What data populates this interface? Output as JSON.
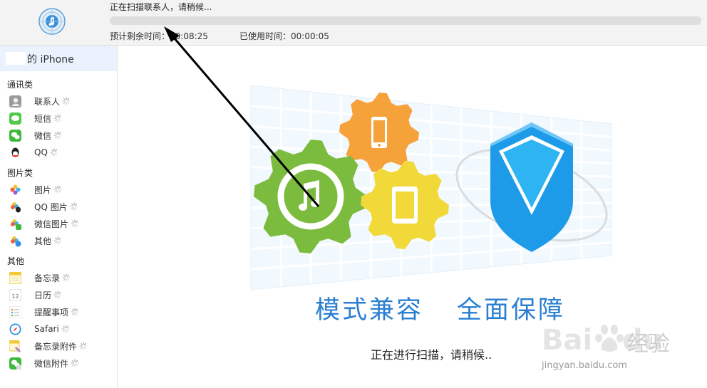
{
  "header": {
    "status_text": "正在扫描联系人，请稍候...",
    "progress_fraction": 0.0,
    "time_remaining": "预计剩余时间：00:08:25",
    "time_used": "已使用时间：00:00:05"
  },
  "sidebar": {
    "device_name": "的 iPhone",
    "groups": [
      {
        "title": "通讯类",
        "items": [
          {
            "label": "联系人",
            "icon": "contacts-icon"
          },
          {
            "label": "短信",
            "icon": "messages-icon"
          },
          {
            "label": "微信",
            "icon": "wechat-icon"
          },
          {
            "label": "QQ",
            "icon": "qq-icon"
          }
        ]
      },
      {
        "title": "图片类",
        "items": [
          {
            "label": "图片",
            "icon": "photos-icon"
          },
          {
            "label": "QQ 图片",
            "icon": "qq-photos-icon"
          },
          {
            "label": "微信图片",
            "icon": "wechat-photos-icon"
          },
          {
            "label": "其他",
            "icon": "other-photos-icon"
          }
        ]
      },
      {
        "title": "其他",
        "items": [
          {
            "label": "备忘录",
            "icon": "notes-icon"
          },
          {
            "label": "日历",
            "icon": "calendar-icon"
          },
          {
            "label": "提醒事项",
            "icon": "reminders-icon"
          },
          {
            "label": "Safari",
            "icon": "safari-icon"
          },
          {
            "label": "备忘录附件",
            "icon": "notes-attachments-icon"
          },
          {
            "label": "微信附件",
            "icon": "wechat-attachments-icon"
          }
        ]
      }
    ]
  },
  "main": {
    "slogan_left": "模式兼容",
    "slogan_right": "全面保障",
    "scan_message": "正在进行扫描，请稍候.."
  },
  "watermark": {
    "brand": "Baidu经验",
    "url": "jingyan.baidu.com"
  },
  "colors": {
    "accent": "#2a7fd1",
    "gear_green": "#7bbb3d",
    "gear_orange": "#f6a23a",
    "gear_yellow": "#f2d93a",
    "shield_blue": "#1e9be8"
  }
}
